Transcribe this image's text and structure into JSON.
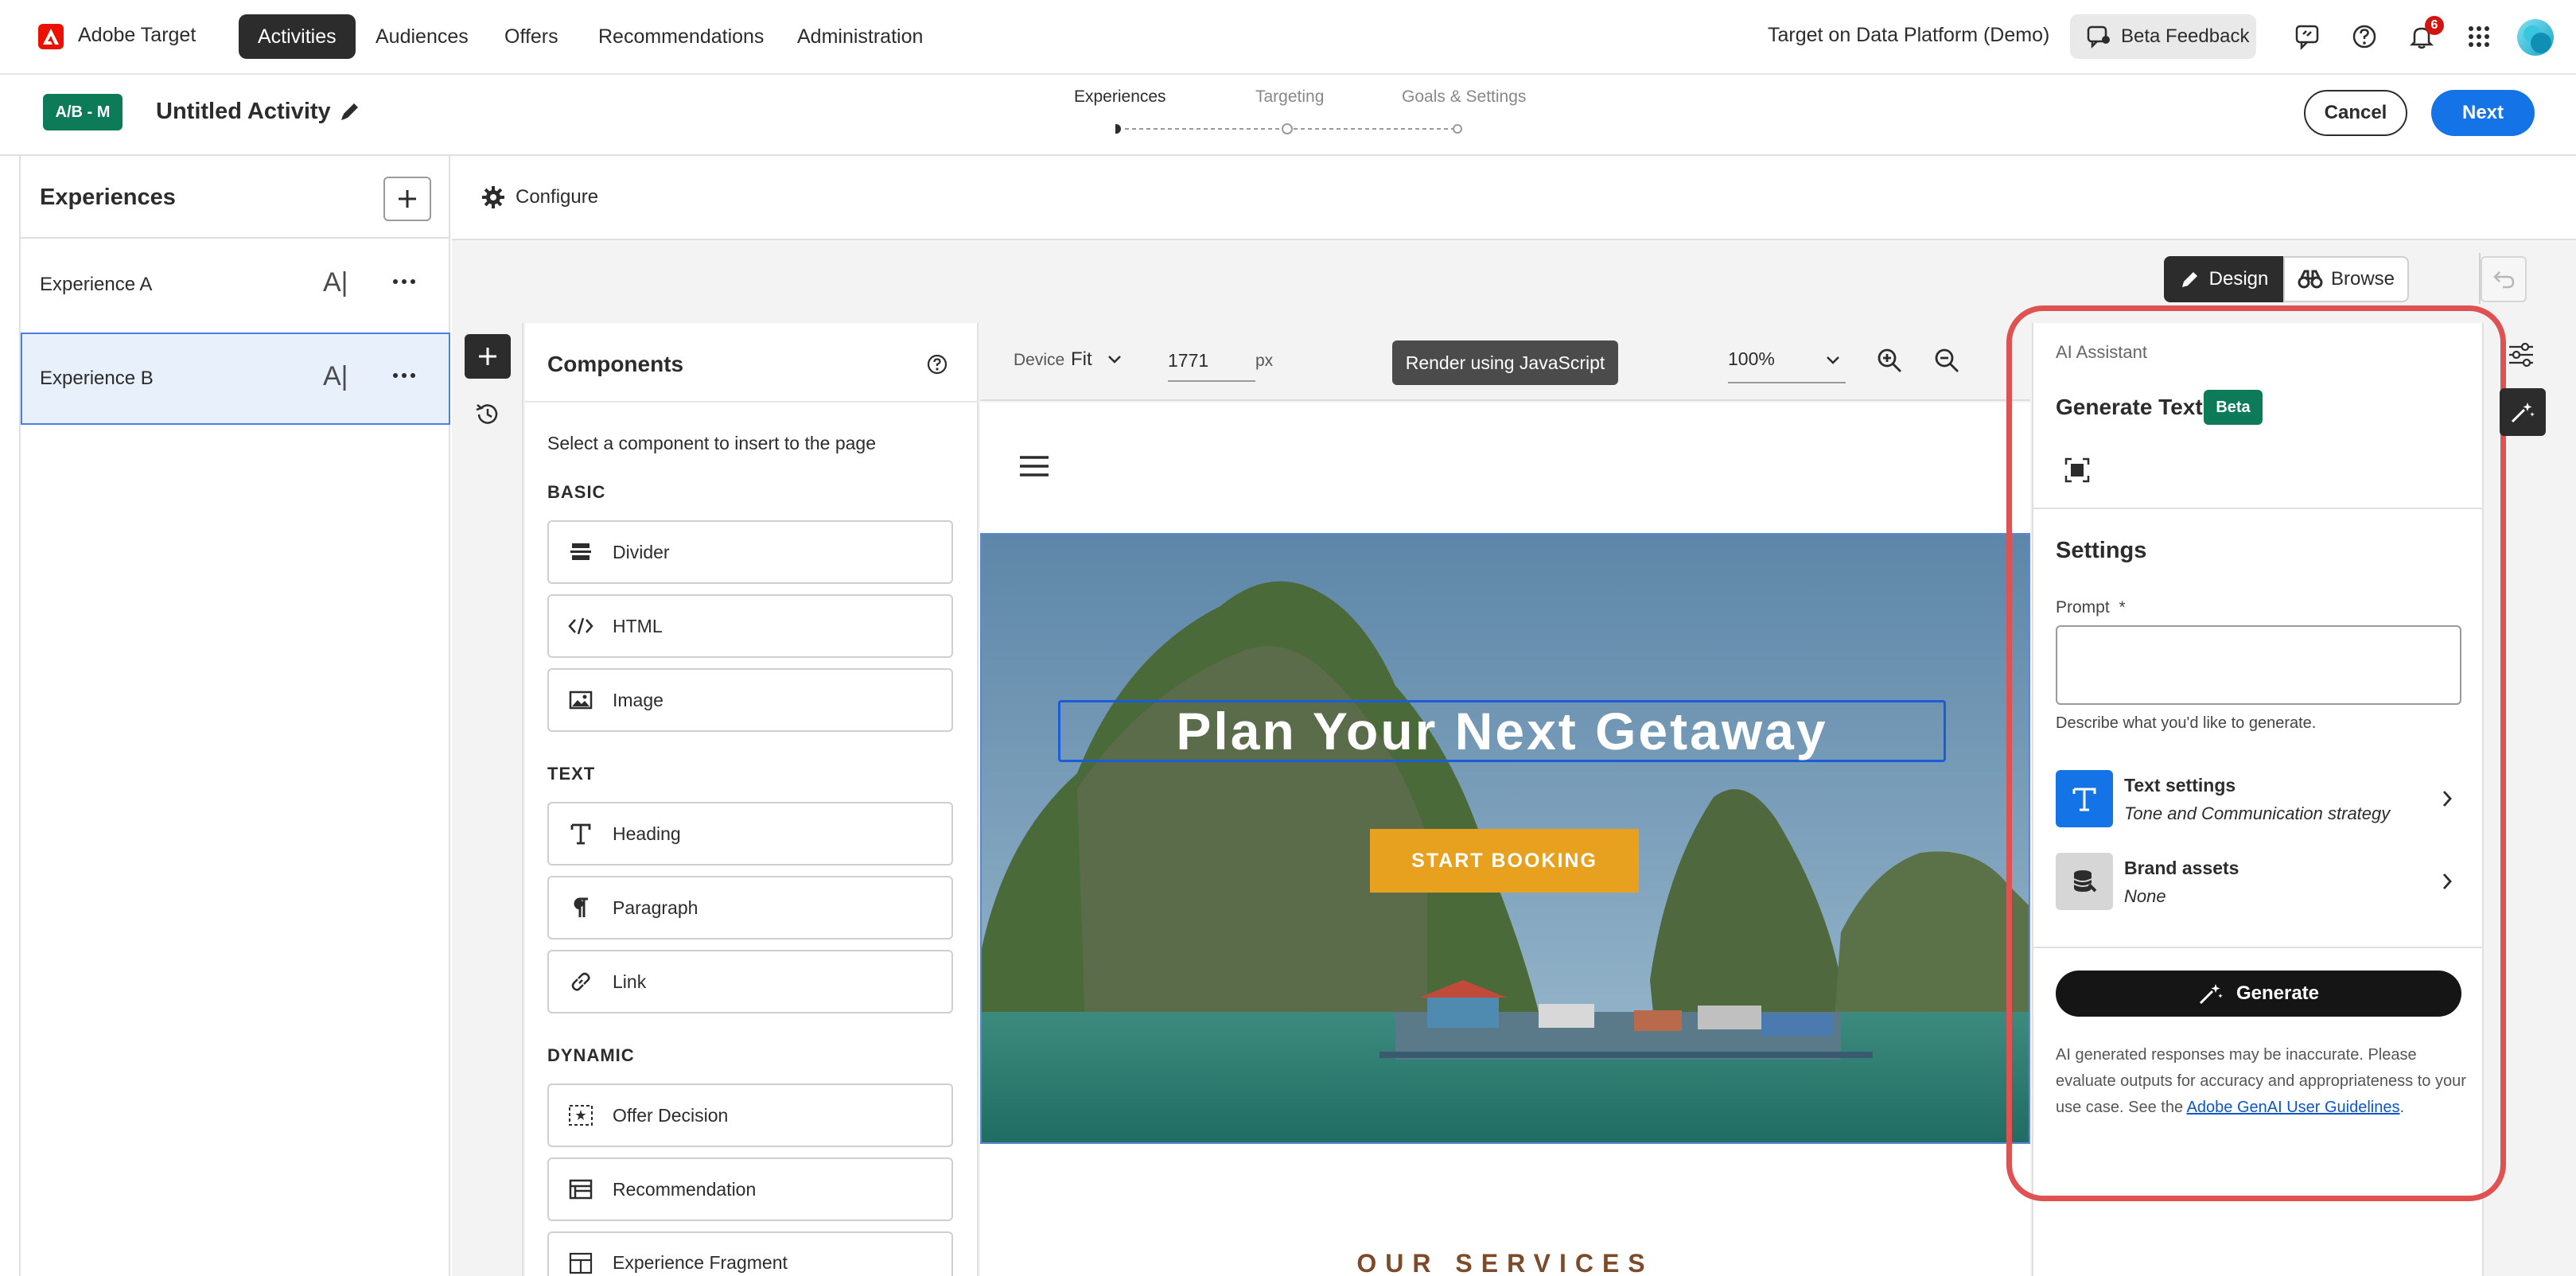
{
  "topnav": {
    "brand": "Adobe Target",
    "tabs": [
      "Activities",
      "Audiences",
      "Offers",
      "Recommendations",
      "Administration"
    ],
    "org": "Target on Data Platform (Demo)",
    "beta_feedback": "Beta Feedback",
    "notifications_count": "6"
  },
  "activity": {
    "badge": "A/B - M",
    "title": "Untitled Activity",
    "steps": [
      "Experiences",
      "Targeting",
      "Goals & Settings"
    ],
    "cancel": "Cancel",
    "next": "Next"
  },
  "experiences": {
    "title": "Experiences",
    "items": [
      {
        "label": "Experience A",
        "ai_glyph": "A|"
      },
      {
        "label": "Experience B",
        "ai_glyph": "A|"
      }
    ]
  },
  "configure": {
    "label": "Configure"
  },
  "mode": {
    "design": "Design",
    "browse": "Browse"
  },
  "components": {
    "title": "Components",
    "hint": "Select a component to insert to the page",
    "categories": [
      {
        "name": "BASIC",
        "items": [
          "Divider",
          "HTML",
          "Image"
        ]
      },
      {
        "name": "TEXT",
        "items": [
          "Heading",
          "Paragraph",
          "Link"
        ]
      },
      {
        "name": "DYNAMIC",
        "items": [
          "Offer Decision",
          "Recommendation",
          "Experience Fragment"
        ]
      }
    ]
  },
  "preview": {
    "device_label": "Device",
    "device_value": "Fit",
    "width_value": "1771",
    "width_unit": "px",
    "render_button": "Render using JavaScript",
    "zoom": "100%",
    "hero_title": "Plan Your Next Getaway",
    "hero_cta": "START BOOKING",
    "services_heading": "OUR SERVICES"
  },
  "ai_panel": {
    "section": "AI Assistant",
    "title": "Generate Text",
    "badge": "Beta",
    "settings_title": "Settings",
    "prompt_label": "Prompt",
    "prompt_required": "*",
    "prompt_value": "",
    "prompt_help": "Describe what you'd like to generate.",
    "text_settings_title": "Text settings",
    "text_settings_sub": "Tone and Communication strategy",
    "brand_assets_title": "Brand assets",
    "brand_assets_sub": "None",
    "generate": "Generate",
    "disclaimer_1": "AI generated responses may be inaccurate. Please",
    "disclaimer_2": "evaluate outputs for accuracy and appropriateness to your",
    "disclaimer_3": "use case. See the",
    "disclaimer_link": "Adobe GenAI User Guidelines",
    "disclaimer_end": "."
  },
  "colors": {
    "accent_blue": "#1473e6",
    "badge_green": "#0d7b58",
    "highlight_red": "#e05252",
    "cta_orange": "#e8a11f"
  }
}
